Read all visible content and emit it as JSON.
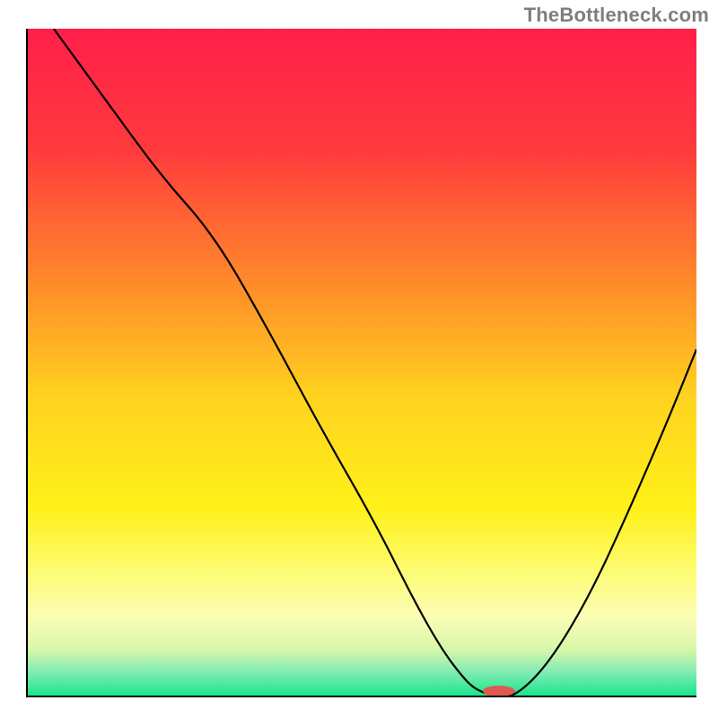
{
  "watermark": "TheBottleneck.com",
  "chart_data": {
    "type": "line",
    "title": "",
    "xlabel": "",
    "ylabel": "",
    "xlim": [
      0,
      100
    ],
    "ylim": [
      0,
      100
    ],
    "grid": false,
    "legend": false,
    "background_gradient_stops": [
      {
        "offset": 0.0,
        "color": "#ff1f4b"
      },
      {
        "offset": 0.18,
        "color": "#ff3a3d"
      },
      {
        "offset": 0.38,
        "color": "#ff8a2a"
      },
      {
        "offset": 0.55,
        "color": "#ffd21f"
      },
      {
        "offset": 0.72,
        "color": "#fff11a"
      },
      {
        "offset": 0.82,
        "color": "#fdfc7a"
      },
      {
        "offset": 0.88,
        "color": "#fcfdb5"
      },
      {
        "offset": 0.93,
        "color": "#d6f7a9"
      },
      {
        "offset": 0.965,
        "color": "#7cebb2"
      },
      {
        "offset": 1.0,
        "color": "#17e68a"
      }
    ],
    "series": [
      {
        "name": "bottleneck-curve",
        "x": [
          4,
          12,
          20,
          28,
          36,
          44,
          52,
          58,
          62,
          65,
          67,
          70,
          73,
          78,
          84,
          90,
          96,
          100
        ],
        "y": [
          100,
          89,
          78,
          69,
          55,
          40,
          26,
          14,
          7,
          3,
          1,
          0,
          0,
          5,
          15,
          28,
          42,
          52
        ]
      }
    ],
    "marker": {
      "name": "optimal-zone",
      "x": 70.5,
      "y": 0.8,
      "color": "#e0584f",
      "rx": 18,
      "ry": 6
    },
    "frame": {
      "inner_left": 30,
      "inner_top": 32,
      "inner_width": 746,
      "inner_height": 744,
      "stroke": "#000000",
      "stroke_width": 2
    }
  }
}
